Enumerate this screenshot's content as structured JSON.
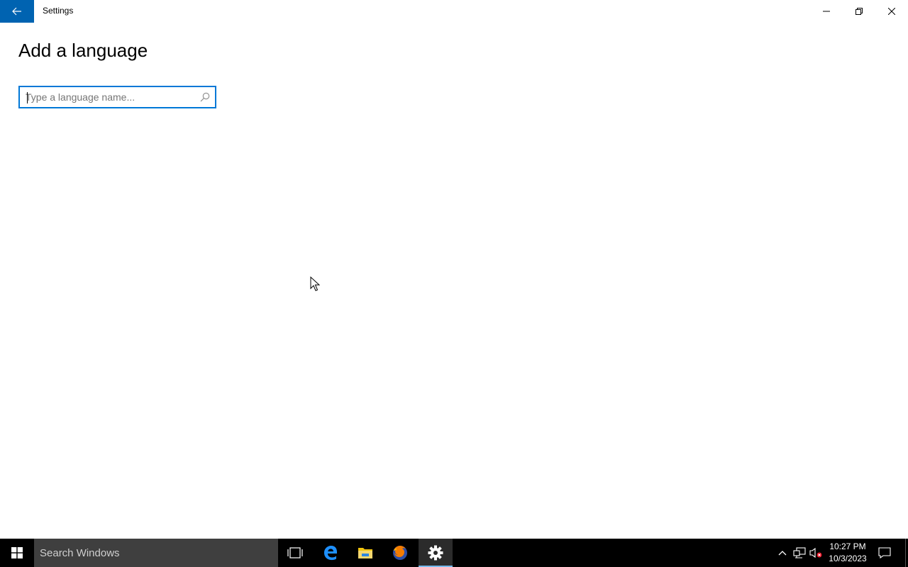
{
  "window": {
    "title": "Settings",
    "back_icon": "back-arrow-icon",
    "controls": [
      "minimize-icon",
      "restore-icon",
      "close-icon"
    ]
  },
  "page": {
    "title": "Add a language"
  },
  "search": {
    "placeholder": "Type a language name...",
    "value": "",
    "icon": "search-icon"
  },
  "taskbar": {
    "search_placeholder": "Search Windows",
    "pinned": [
      "task-view-icon",
      "edge-icon",
      "file-explorer-icon",
      "firefox-icon",
      "settings-icon"
    ],
    "active_app": "settings",
    "clock": {
      "time": "10:27 PM",
      "date": "10/3/2023"
    },
    "tray": [
      "chevron-up-icon",
      "network-icon",
      "volume-muted-icon",
      "notification-icon"
    ]
  },
  "colors": {
    "accent": "#0063b1",
    "focus_border": "#0078d7",
    "taskbar_bg": "#000000",
    "taskbar_search_bg": "#3f3f3f"
  }
}
